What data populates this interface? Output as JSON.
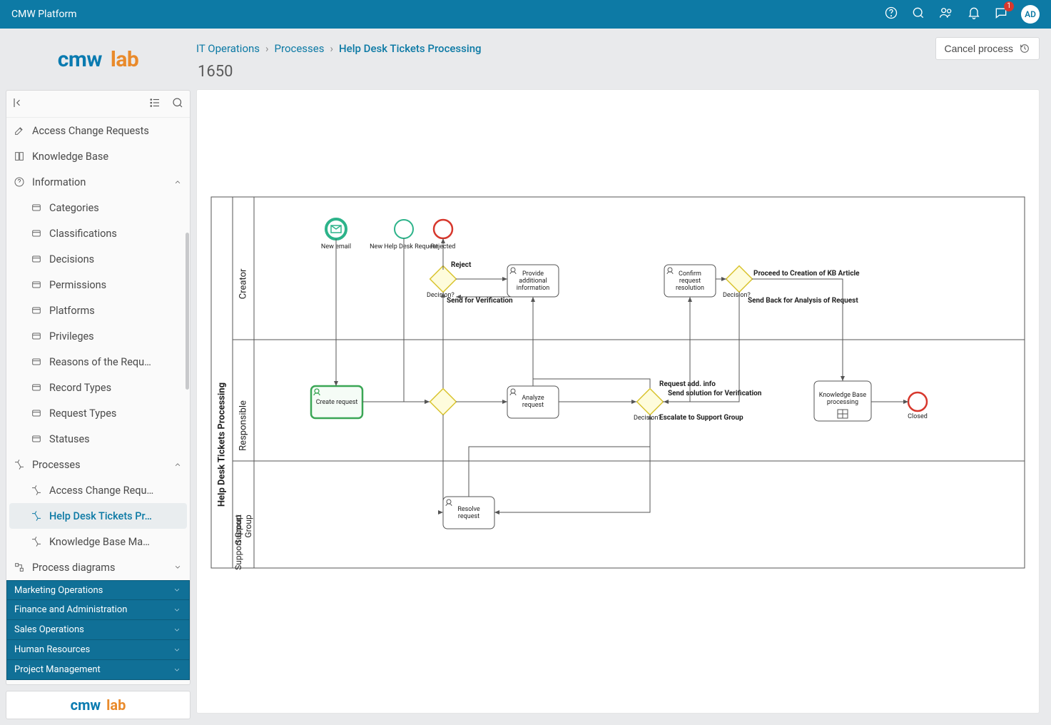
{
  "topbar": {
    "title": "CMW Platform",
    "notif_count": "1",
    "avatar": "AD"
  },
  "logo": {
    "cmw": "cmw",
    "lab": "lab"
  },
  "sidebar": {
    "items": [
      {
        "label": "Access Change Requests",
        "icon": "edit"
      },
      {
        "label": "Knowledge Base",
        "icon": "book"
      },
      {
        "label": "Information",
        "icon": "help",
        "expand": "up",
        "children": [
          {
            "label": "Categories"
          },
          {
            "label": "Classifications"
          },
          {
            "label": "Decisions"
          },
          {
            "label": "Permissions"
          },
          {
            "label": "Platforms"
          },
          {
            "label": "Privileges"
          },
          {
            "label": "Reasons of the Requ…"
          },
          {
            "label": "Record Types"
          },
          {
            "label": "Request Types"
          },
          {
            "label": "Statuses"
          }
        ]
      },
      {
        "label": "Processes",
        "icon": "proc",
        "expand": "up",
        "children": [
          {
            "label": "Access Change Requ…"
          },
          {
            "label": "Help Desk Tickets Pr…",
            "active": true
          },
          {
            "label": "Knowledge Base Ma…"
          }
        ]
      },
      {
        "label": "Process diagrams",
        "icon": "diag",
        "expand": "down"
      }
    ],
    "dark": [
      "Marketing Operations",
      "Finance and Administration",
      "Sales Operations",
      "Human Resources",
      "Project Management"
    ]
  },
  "breadcrumbs": [
    "IT Operations",
    "Processes",
    "Help Desk Tickets Processing"
  ],
  "page_id": "1650",
  "cancel": "Cancel process",
  "diagram": {
    "pool": "Help Desk Tickets Processing",
    "lanes": [
      "Creator",
      "Responsible",
      "Support Group"
    ],
    "events": {
      "start1": "New email",
      "start2": "New Help Desk Request",
      "end_reject": "Rejected",
      "end_closed": "Closed"
    },
    "tasks": {
      "create": "Create request",
      "provide": "Provide additional information",
      "confirm": "Confirm request resolution",
      "analyze": "Analyze request",
      "kb": "Knowledge Base processing",
      "resolve": "Resolve request"
    },
    "gateways": {
      "decision": "Decision?"
    },
    "flows": {
      "reject": "Reject",
      "send_verif": "Send for Verification",
      "proceed_kb": "Proceed to Creation of KB Article",
      "send_back": "Send Back for Analysis of Request",
      "req_add": "Request add. info",
      "send_sol": "Send solution for Verification",
      "escalate": "Escalate to Support Group"
    }
  }
}
